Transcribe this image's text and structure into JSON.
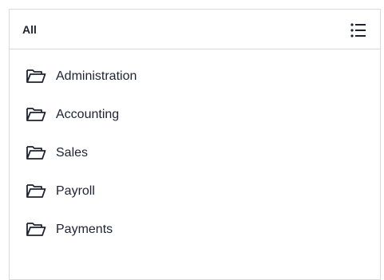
{
  "header": {
    "title": "All",
    "list_view_icon": "list-bullets-icon"
  },
  "folders": {
    "icon": "folder-open-icon",
    "items": [
      {
        "label": "Administration"
      },
      {
        "label": "Accounting"
      },
      {
        "label": "Sales"
      },
      {
        "label": "Payroll"
      },
      {
        "label": "Payments"
      }
    ]
  },
  "colors": {
    "text": "#1e2233",
    "border": "#d9d9d9",
    "background": "#ffffff"
  }
}
